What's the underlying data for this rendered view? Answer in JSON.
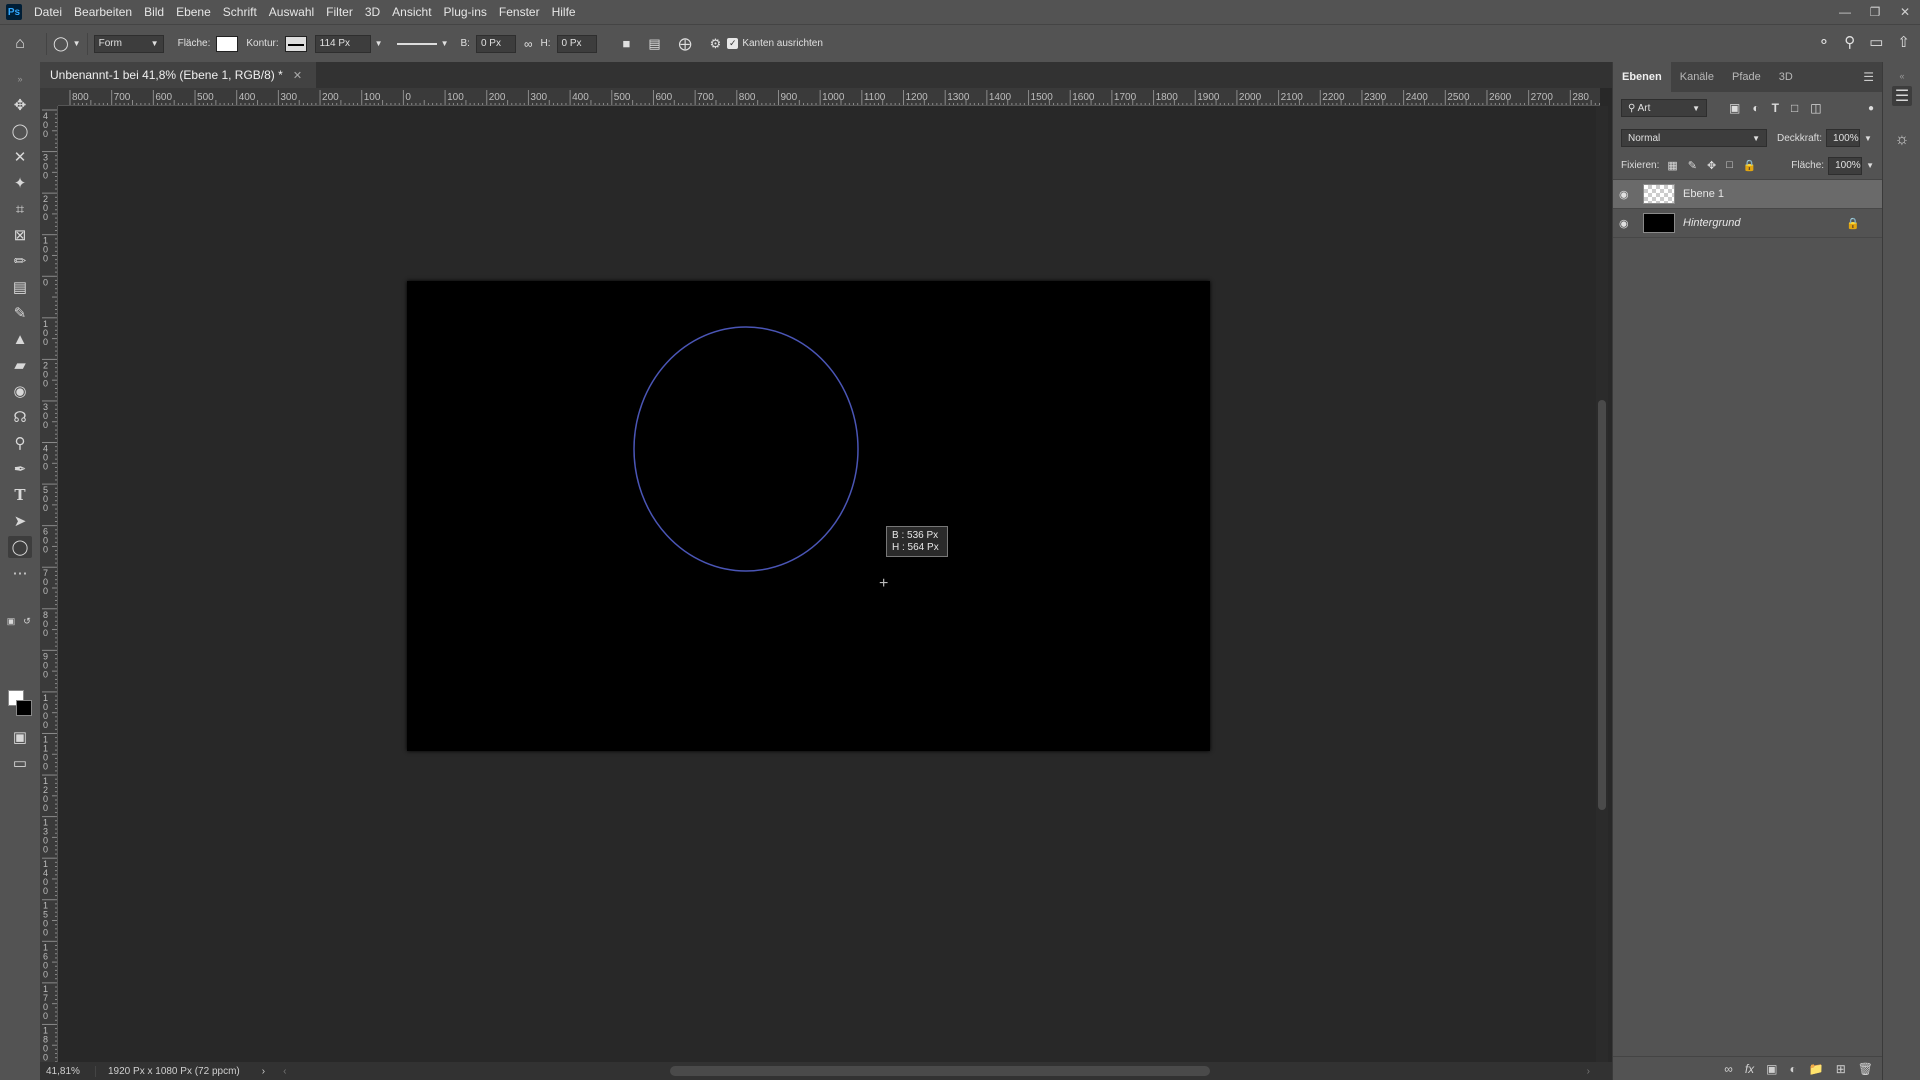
{
  "app": {
    "logo": "Ps"
  },
  "menu": [
    "Datei",
    "Bearbeiten",
    "Bild",
    "Ebene",
    "Schrift",
    "Auswahl",
    "Filter",
    "3D",
    "Ansicht",
    "Plug-ins",
    "Fenster",
    "Hilfe"
  ],
  "options": {
    "mode": "Form",
    "fill_label": "Fläche:",
    "stroke_label": "Kontur:",
    "stroke_width": "114 Px",
    "width_label": "B:",
    "width_value": "0 Px",
    "height_label": "H:",
    "height_value": "0 Px",
    "align_edges_label": "Kanten ausrichten"
  },
  "document": {
    "tab_title": "Unbenannt-1 bei 41,8% (Ebene 1, RGB/8) *",
    "zoom": "41,81%",
    "size_info": "1920 Px x 1080 Px (72 ppcm)"
  },
  "ruler": {
    "h_labels": [
      "800",
      "700",
      "600",
      "500",
      "400",
      "300",
      "200",
      "100",
      "0",
      "100",
      "200",
      "300",
      "400",
      "500",
      "600",
      "700",
      "800",
      "900",
      "1000",
      "1100",
      "1200",
      "1300",
      "1400",
      "1500",
      "1600",
      "1700",
      "1800",
      "1900",
      "2000",
      "2100",
      "2200",
      "2300",
      "2400",
      "2500",
      "2600",
      "2700",
      "280"
    ],
    "v_labels": [
      "4 0 0",
      "3 0 0",
      "2 0 0",
      "1 0 0",
      "0",
      "1 0 0",
      "2 0 0",
      "3 0 0",
      "4 0 0",
      "5 0 0",
      "6 0 0",
      "7 0 0",
      "8 0 0",
      "9 0 0",
      "1 0 0 0",
      "1 1 0 0",
      "1 2 0 0",
      "1 3 0 0",
      "1 4 0 0",
      "1 5 0 0",
      "1 6 0 0",
      "1 7 0 0",
      "1 8 0 0"
    ]
  },
  "tooltip": {
    "w": "B :  536 Px",
    "h": "H :  564 Px"
  },
  "panel": {
    "tabs": [
      "Ebenen",
      "Kanäle",
      "Pfade",
      "3D"
    ],
    "filter": "Art",
    "blend_mode": "Normal",
    "opacity_label": "Deckkraft:",
    "opacity_value": "100%",
    "lock_label": "Fixieren:",
    "fill_label": "Fläche:",
    "fill_value": "100%",
    "layers": [
      {
        "name": "Ebene 1"
      },
      {
        "name": "Hintergrund"
      }
    ]
  },
  "colors": {
    "circle_stroke": "#4a55b5",
    "accent": "#31a8ff"
  }
}
